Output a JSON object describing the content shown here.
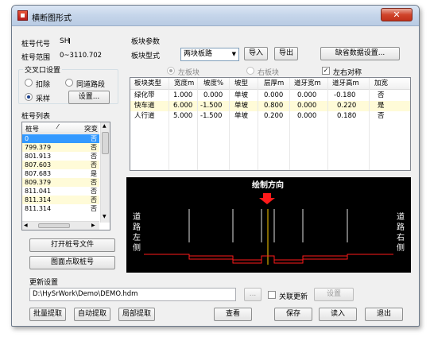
{
  "window": {
    "title": "横断图形式",
    "close": "✕"
  },
  "stake": {
    "code_label": "桩号代号",
    "code_value": "SH",
    "range_label": "桩号范围",
    "range_value": "0~3110.702"
  },
  "intersection": {
    "group_label": "交叉口设置",
    "opt_deduct": "扣除",
    "opt_same_road": "同道路段",
    "opt_sample": "采样",
    "settings_btn": "设置...",
    "selected": "采样"
  },
  "stake_list": {
    "group_label": "桩号列表",
    "headers": [
      "桩号",
      "突变"
    ],
    "rows": [
      {
        "stake": "0",
        "mutation": "否"
      },
      {
        "stake": "799.379",
        "mutation": "否"
      },
      {
        "stake": "801.913",
        "mutation": "否"
      },
      {
        "stake": "807.603",
        "mutation": "否"
      },
      {
        "stake": "807.683",
        "mutation": "是"
      },
      {
        "stake": "809.379",
        "mutation": "否"
      },
      {
        "stake": "811.041",
        "mutation": "否"
      },
      {
        "stake": "811.314",
        "mutation": "否"
      },
      {
        "stake": "811.314",
        "mutation": "否"
      }
    ]
  },
  "buttons_left": {
    "open_file": "打开桩号文件",
    "pick_from_drawing": "图面点取桩号"
  },
  "slab": {
    "group_label": "板块参数",
    "type_label": "板块型式",
    "type_value": "两块板路",
    "import_btn": "导入",
    "export_btn": "导出",
    "default_btn": "缺省数据设置...",
    "left_block": "左板块",
    "right_block": "右板块",
    "symmetric": "左右对称",
    "symmetric_checked": true,
    "headers": [
      "板块类型",
      "宽度m",
      "坡度%",
      "坡型",
      "层厚m",
      "道牙宽m",
      "道牙高m",
      "加宽"
    ],
    "rows": [
      [
        "绿化带",
        "1.000",
        "0.000",
        "单坡",
        "0.000",
        "0.000",
        "-0.180",
        "否"
      ],
      [
        "快车道",
        "6.000",
        "-1.500",
        "单坡",
        "0.800",
        "0.000",
        "0.220",
        "是"
      ],
      [
        "人行道",
        "5.000",
        "-1.500",
        "单坡",
        "0.200",
        "0.000",
        "0.180",
        "否"
      ]
    ]
  },
  "preview": {
    "direction_label": "绘制方向",
    "left_side": "道路左侧",
    "right_side": "道路右侧"
  },
  "update": {
    "group_label": "更新设置",
    "path_value": "D:\\HySrWork\\Demo\\DEMO.hdm",
    "browse_btn": "...",
    "link_update": "关联更新",
    "settings_btn": "设置"
  },
  "bottom_buttons": {
    "batch_extract": "批量提取",
    "auto_extract": "自动提取",
    "partial_extract": "局部提取",
    "view": "查看",
    "save": "保存",
    "load": "读入",
    "exit": "退出"
  },
  "colors": {
    "accent": "#ff0000",
    "preview_bg": "#000000",
    "highlight_row": "#fffbd8",
    "selection": "#3399ff"
  }
}
